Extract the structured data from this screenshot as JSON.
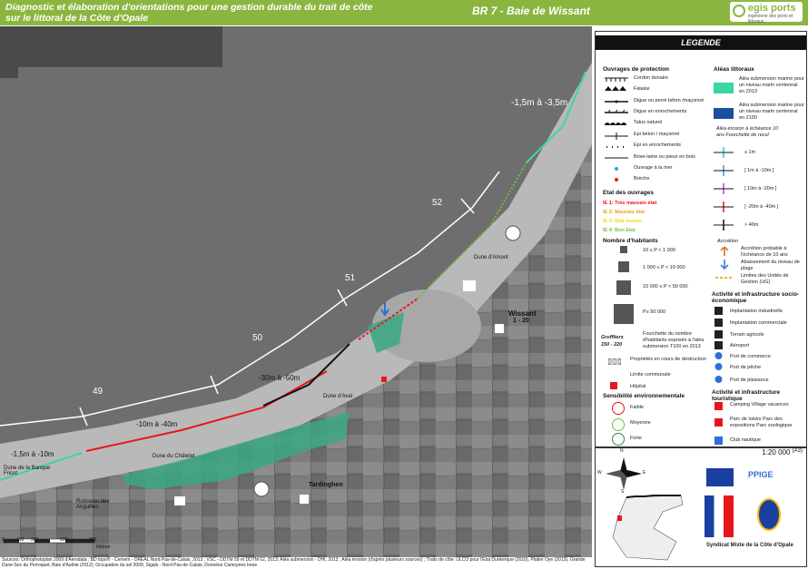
{
  "header": {
    "title": "Diagnostic et élaboration d'orientations pour une gestion durable du trait de côte sur le littoral de la Côte d'Opale",
    "map_ref": "BR 7 - Baie de Wissant",
    "logo_name": "egis ports",
    "logo_tagline": "ingénierie des ports et littoraux"
  },
  "map": {
    "labels": {
      "seg_top": "-1,5m à -3,5m",
      "seg_mid": "-30m à -50m",
      "seg_left_mid": "-10m à -40m",
      "seg_left": "-1,5m à -10m",
      "n52": "52",
      "n51": "51",
      "n50": "50",
      "n49": "49",
      "dune_amont": "Dune d'Amont",
      "wissant": "Wissant",
      "wissant_range": "1 - 20",
      "dune_aval": "Dune d'Aval",
      "dune_chatelet": "Dune du Châtelet",
      "dune_banque": "Dune de la Banque Fricot",
      "ruisseau": "Ruisseau des Anguilles",
      "tardinghen": "Tardinghen"
    },
    "scale_ticks": [
      "0",
      "150",
      "300",
      "600",
      "900"
    ],
    "scale_unit": "Mètres",
    "sources": "Sources: Orthophotoplan 2009 d'Aerodata ; BD topo® - Cemem - DREAL Nord Pas-de-Calais, 2013 ; VSC - DDTM 59 et DDTM 62, 2013; Aléa submersion - DHI, 2013 ; Aléa érosion (d'après plusieurs sources) ; Traits de côte: ULCO pour l'Etat Dunkerque (2010), Platier Oye (2013), Grande Dune-Sec du Perroquet, Baie d'Authie (2012); Occupation du sol 2009, Sigale - Nord Pas-de-Calais; Données Camoyées Irese"
  },
  "legend": {
    "title": "LEGENDE",
    "ouvrages_title": "Ouvrages de protection",
    "ouvrages": [
      "Cordon dunaire",
      "Falaise",
      "Digue ou perré béton /maçonné",
      "Digue en enrochements",
      "Talus naturel",
      "Epi béton / maçonné",
      "Epi en enrochements",
      "Brise-lame ou pieux en bois",
      "Ouvrage à la mer",
      "Brèche"
    ],
    "etat_title": "Etat des ouvrages",
    "etats": [
      {
        "label": "IE 1: Très mauvais état",
        "color": "#e8161c"
      },
      {
        "label": "IE 2: Mauvais état",
        "color": "#f39a1e"
      },
      {
        "label": "IE 3: Etat moyen",
        "color": "#f5d90a"
      },
      {
        "label": "IE 4: Bon Etat",
        "color": "#6dbf3e"
      }
    ],
    "habitants_title": "Nombre d'habitants",
    "habitants": [
      "10 ≤ P < 1 000",
      "1 000 ≤ P < 10 000",
      "10 000 ≤ P < 50 000",
      "P≥ 50 000"
    ],
    "fourchette_ex_name": "Groffliers",
    "fourchette_ex_range": "150 - 220",
    "fourchette_text": "Fourchette du nombre d'habitants exposés à l'aléa submersion T100 en 2013",
    "proprietes": "Propriétés en cours de destruction",
    "limite": "Limite communale",
    "hopital": "Hôpital",
    "sensibilite_title": "Sensibilité environnementale",
    "sensibilite": [
      "Faible",
      "Moyenne",
      "Forte"
    ],
    "aleas_title": "Aléas littoraux",
    "aleas": [
      {
        "label": "Aléa submersion marine pour un niveau marin centennal en 2013",
        "color": "#3bd6a3"
      },
      {
        "label": "Aléa submersion marine pour un niveau marin centennal en 2100",
        "color": "#1b4fa0"
      }
    ],
    "erosion_title": "Aléa érosion à échéance 10 ans Fourchette de recul",
    "erosion": [
      {
        "label": "≤ 1m",
        "color": "#39c8c8"
      },
      {
        "label": "] 1m à -10m ]",
        "color": "#2f9fd8"
      },
      {
        "label": "] 10m à -20m ]",
        "color": "#c23bd8"
      },
      {
        "label": "] -20m à -40m ]",
        "color": "#e8161c"
      },
      {
        "label": "> 40m",
        "color": "#111111"
      }
    ],
    "accretion_title": "Accrétion",
    "accretion": [
      "Accrétion probable à l'échéance de 10 ans",
      "Abaissement du niveau de plage",
      "Limites des Unités de Gestion (UG)"
    ],
    "socio_title": "Activité et infrastructure socio-économique",
    "socio": [
      "Implantation industrielle",
      "Implantation commerciale",
      "Terrain agricole",
      "Aéroport",
      "Port de commerce",
      "Port de pêche",
      "Port de plaisance"
    ],
    "touris_title": "Activité et infrastructure touristique",
    "touris": [
      "Camping Village vacances",
      "Parc de loisirs Parc des expositions Parc zoologique",
      "Club nautique"
    ]
  },
  "bottom": {
    "scale": "1:20 000",
    "paper": "(A3)",
    "compass": [
      "N",
      "S",
      "E",
      "W"
    ],
    "partner_ppige": "PPIGE",
    "partner_syndicat": "Syndicat Mixte de la Côte d'Opale"
  }
}
